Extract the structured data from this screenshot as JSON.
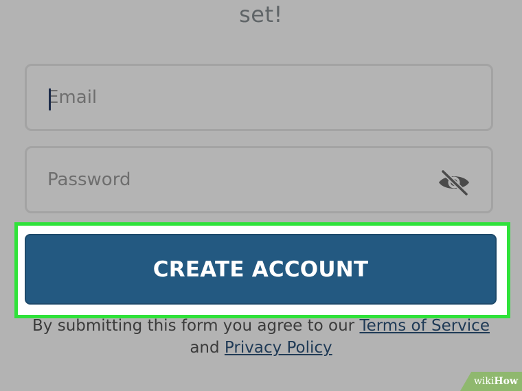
{
  "header": {
    "partial_heading": "set!"
  },
  "form": {
    "email_placeholder": "Email",
    "password_placeholder": "Password",
    "password_toggle_icon": "eye-slash-icon",
    "submit_label": "CREATE ACCOUNT"
  },
  "legal": {
    "prefix": "By submitting this form you agree to our ",
    "terms_link": "Terms of Service",
    "middle": "and ",
    "privacy_link": "Privacy Policy"
  },
  "watermark": {
    "part1": "wiki",
    "part2": "How"
  },
  "colors": {
    "background": "#b3b3b3",
    "button": "#235981",
    "highlight_outline": "#2fe23a",
    "link": "#1f3a56"
  }
}
